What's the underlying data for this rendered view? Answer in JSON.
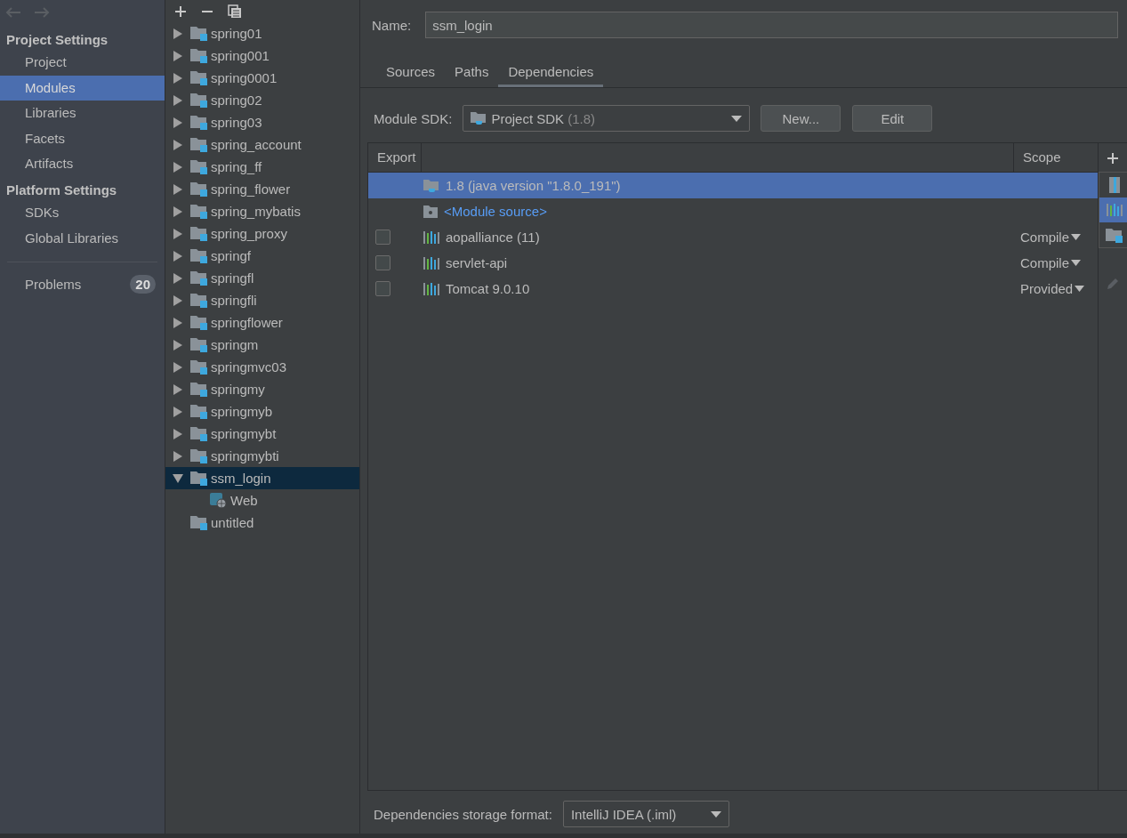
{
  "sidebar": {
    "sections": [
      {
        "title": "Project Settings",
        "items": [
          {
            "label": "Project",
            "selected": false
          },
          {
            "label": "Modules",
            "selected": true
          },
          {
            "label": "Libraries",
            "selected": false
          },
          {
            "label": "Facets",
            "selected": false
          },
          {
            "label": "Artifacts",
            "selected": false
          }
        ]
      },
      {
        "title": "Platform Settings",
        "items": [
          {
            "label": "SDKs",
            "selected": false
          },
          {
            "label": "Global Libraries",
            "selected": false
          }
        ]
      }
    ],
    "problems": {
      "label": "Problems",
      "count": "20"
    }
  },
  "modules": {
    "items": [
      {
        "label": "spring01",
        "expandable": true,
        "expanded": false,
        "selected": false
      },
      {
        "label": "spring001",
        "expandable": true,
        "expanded": false,
        "selected": false
      },
      {
        "label": "spring0001",
        "expandable": true,
        "expanded": false,
        "selected": false
      },
      {
        "label": "spring02",
        "expandable": true,
        "expanded": false,
        "selected": false
      },
      {
        "label": "spring03",
        "expandable": true,
        "expanded": false,
        "selected": false
      },
      {
        "label": "spring_account",
        "expandable": true,
        "expanded": false,
        "selected": false
      },
      {
        "label": "spring_ff",
        "expandable": true,
        "expanded": false,
        "selected": false
      },
      {
        "label": "spring_flower",
        "expandable": true,
        "expanded": false,
        "selected": false
      },
      {
        "label": "spring_mybatis",
        "expandable": true,
        "expanded": false,
        "selected": false
      },
      {
        "label": "spring_proxy",
        "expandable": true,
        "expanded": false,
        "selected": false
      },
      {
        "label": "springf",
        "expandable": true,
        "expanded": false,
        "selected": false
      },
      {
        "label": "springfl",
        "expandable": true,
        "expanded": false,
        "selected": false
      },
      {
        "label": "springfli",
        "expandable": true,
        "expanded": false,
        "selected": false
      },
      {
        "label": "springflower",
        "expandable": true,
        "expanded": false,
        "selected": false
      },
      {
        "label": "springm",
        "expandable": true,
        "expanded": false,
        "selected": false
      },
      {
        "label": "springmvc03",
        "expandable": true,
        "expanded": false,
        "selected": false
      },
      {
        "label": "springmy",
        "expandable": true,
        "expanded": false,
        "selected": false
      },
      {
        "label": "springmyb",
        "expandable": true,
        "expanded": false,
        "selected": false
      },
      {
        "label": "springmybt",
        "expandable": true,
        "expanded": false,
        "selected": false
      },
      {
        "label": "springmybti",
        "expandable": true,
        "expanded": false,
        "selected": false
      },
      {
        "label": "ssm_login",
        "expandable": true,
        "expanded": true,
        "selected": true,
        "children": [
          {
            "label": "Web",
            "selected": false
          }
        ]
      },
      {
        "label": "untitled",
        "expandable": false,
        "expanded": false,
        "selected": false
      }
    ]
  },
  "name": {
    "label": "Name:",
    "value": "ssm_login"
  },
  "tabs": [
    {
      "label": "Sources",
      "selected": false
    },
    {
      "label": "Paths",
      "selected": false
    },
    {
      "label": "Dependencies",
      "selected": true
    }
  ],
  "module_sdk": {
    "label": "Module SDK:",
    "value": "Project SDK",
    "version": "(1.8)",
    "buttons": [
      "New...",
      "Edit"
    ]
  },
  "table": {
    "columns": [
      "Export",
      "Scope"
    ],
    "rows": [
      {
        "kind": "sdk",
        "name": "1.8 (java version \"1.8.0_191\")",
        "selected": true
      },
      {
        "kind": "source",
        "name": "<Module source>",
        "selected": false
      },
      {
        "kind": "library",
        "name": "aopalliance (11)",
        "checked": false,
        "scope": "Compile",
        "selected": false
      },
      {
        "kind": "library",
        "name": "servlet-api",
        "checked": false,
        "scope": "Compile",
        "selected": false
      },
      {
        "kind": "library",
        "name": "Tomcat 9.0.10",
        "checked": false,
        "scope": "Provided",
        "selected": false
      }
    ]
  },
  "add_menu": {
    "items": [
      {
        "kind": "jar",
        "selected": false
      },
      {
        "kind": "library",
        "selected": true
      },
      {
        "kind": "module",
        "selected": false
      }
    ]
  },
  "storage": {
    "label": "Dependencies storage format:",
    "value": "IntelliJ IDEA (.iml)"
  }
}
